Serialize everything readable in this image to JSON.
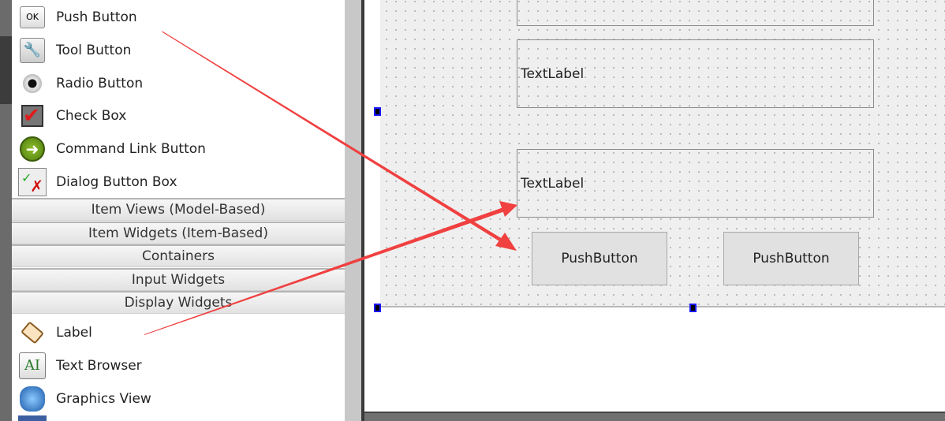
{
  "widget_box": {
    "buttons": [
      {
        "label": "Push Button",
        "icon": "ok-button-icon"
      },
      {
        "label": "Tool Button",
        "icon": "wrench-icon"
      },
      {
        "label": "Radio Button",
        "icon": "radio-icon"
      },
      {
        "label": "Check Box",
        "icon": "checkbox-icon"
      },
      {
        "label": "Command Link Button",
        "icon": "arrow-circle-icon"
      },
      {
        "label": "Dialog Button Box",
        "icon": "dialog-button-box-icon"
      }
    ],
    "ok_icon_text": "OK",
    "categories": [
      "Item Views (Model-Based)",
      "Item Widgets (Item-Based)",
      "Containers",
      "Input Widgets",
      "Display Widgets"
    ],
    "display_widgets": [
      {
        "label": "Label",
        "icon": "label-tag-icon"
      },
      {
        "label": "Text Browser",
        "icon": "text-browser-icon"
      },
      {
        "label": "Graphics View",
        "icon": "graphics-view-icon"
      }
    ],
    "text_browser_icon_text": "AI"
  },
  "form": {
    "labels": [
      "TextLabel",
      "TextLabel"
    ],
    "push_buttons": [
      "PushButton",
      "PushButton"
    ]
  },
  "colors": {
    "annotation_arrow": "#f04040",
    "selection_handle": "#1a1aff"
  }
}
